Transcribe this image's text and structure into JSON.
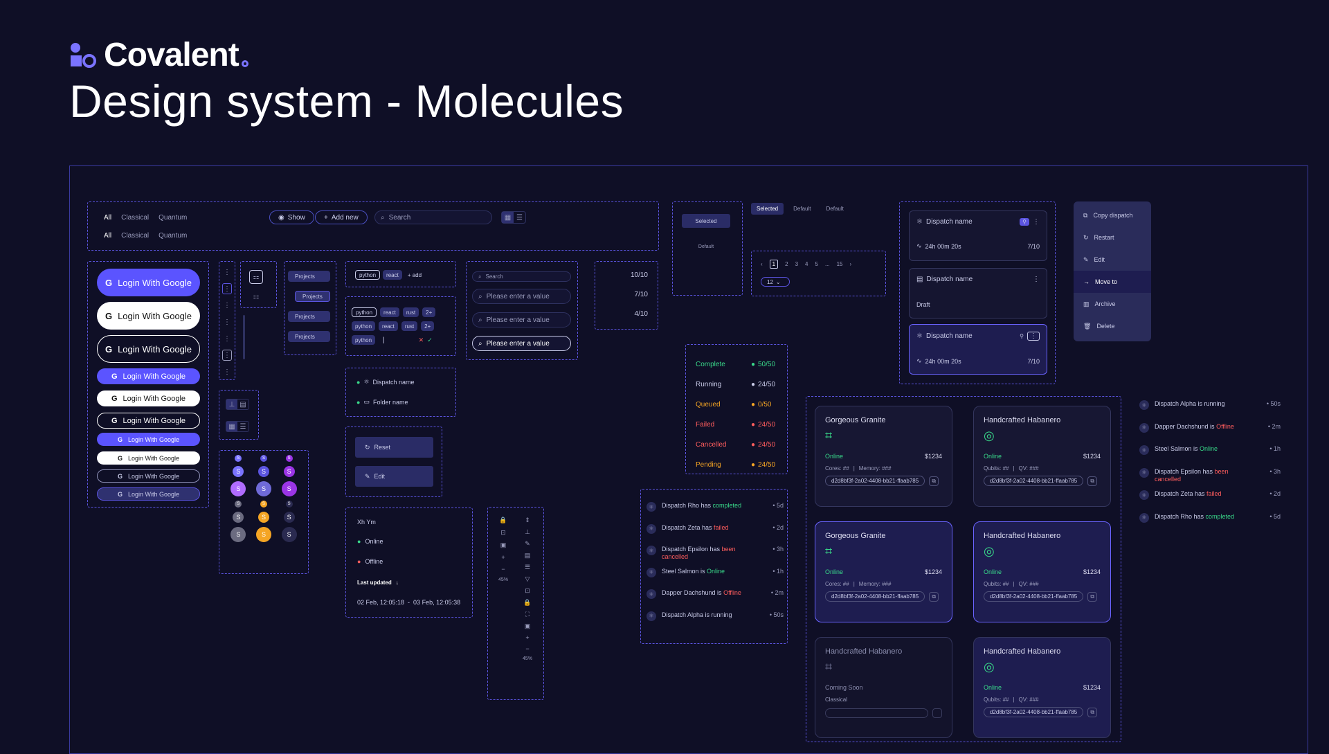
{
  "brand": {
    "name": "Covalent"
  },
  "page": {
    "title": "Design system - Molecules"
  },
  "filters": {
    "row1": [
      "All",
      "Classical",
      "Quantum"
    ],
    "row2": [
      "All",
      "Classical",
      "Quantum"
    ],
    "show": "Show",
    "add_new": "Add new",
    "search_placeholder": "Search"
  },
  "login": {
    "label": "Login With Google"
  },
  "sidebar_projects": [
    "Projects",
    "Projects",
    "Projects",
    "Projects"
  ],
  "tags": {
    "row1": [
      "python",
      "react",
      "+ add"
    ],
    "grid": [
      [
        "python",
        "react",
        "rust",
        "2+"
      ],
      [
        "python",
        "react",
        "rust",
        "2+"
      ],
      [
        "python"
      ]
    ]
  },
  "inputs": {
    "search": "Search",
    "placeholder": "Please enter a value"
  },
  "counts": [
    "10/10",
    "7/10",
    "4/10"
  ],
  "selector": {
    "selected": "Selected",
    "default": "Default"
  },
  "tabs": [
    "Selected",
    "Default",
    "Default"
  ],
  "pagination": {
    "pages": [
      "1",
      "2",
      "3",
      "4",
      "5",
      "...",
      "15"
    ],
    "per_page": "12"
  },
  "tree": {
    "dispatch": "Dispatch name",
    "folder": "Folder name"
  },
  "menu_buttons": {
    "reset": "Reset",
    "edit": "Edit"
  },
  "user_panel": {
    "initials": "Xh Ym",
    "online": "Online",
    "offline": "Offline",
    "last_updated": "Last updated",
    "range": "02 Feb, 12:05:18  -  03 Feb, 12:05:38"
  },
  "zoom": "45%",
  "status_list": [
    {
      "label": "Complete",
      "count": "50/50",
      "color": "#39d98a"
    },
    {
      "label": "Running",
      "count": "24/50",
      "color": "#c9cbe8"
    },
    {
      "label": "Queued",
      "count": "0/50",
      "color": "#f5a524"
    },
    {
      "label": "Failed",
      "count": "24/50",
      "color": "#ff5d5d"
    },
    {
      "label": "Cancelled",
      "count": "24/50",
      "color": "#ff5d5d"
    },
    {
      "label": "Pending",
      "count": "24/50",
      "color": "#f5a524"
    }
  ],
  "activity": [
    {
      "pre": "Dispatch Rho has ",
      "hl": "completed",
      "post": "",
      "cls": "ok",
      "time": "5d"
    },
    {
      "pre": "Dispatch Zeta has ",
      "hl": "failed",
      "post": "",
      "cls": "bad",
      "time": "2d"
    },
    {
      "pre": "Dispatch Epsilon has ",
      "hl": "been cancelled",
      "post": "",
      "cls": "bad",
      "time": "3h"
    },
    {
      "pre": "Steel Salmon is ",
      "hl": "Online",
      "post": "",
      "cls": "ok",
      "time": "1h"
    },
    {
      "pre": "Dapper Dachshund is ",
      "hl": "Offline",
      "post": "",
      "cls": "bad",
      "time": "2m"
    },
    {
      "pre": "Dispatch Alpha is running",
      "hl": "",
      "post": "",
      "cls": "",
      "time": "50s"
    }
  ],
  "activity_right": [
    {
      "pre": "Dispatch Alpha is running",
      "hl": "",
      "cls": "",
      "time": "50s"
    },
    {
      "pre": "Dapper Dachshund is ",
      "hl": "Offline",
      "cls": "bad",
      "time": "2m"
    },
    {
      "pre": "Steel Salmon is ",
      "hl": "Online",
      "cls": "ok",
      "time": "1h"
    },
    {
      "pre": "Dispatch Epsilon has ",
      "hl": "been cancelled",
      "cls": "bad",
      "time": "3h"
    },
    {
      "pre": "Dispatch Zeta has ",
      "hl": "failed",
      "cls": "bad",
      "time": "2d"
    },
    {
      "pre": "Dispatch Rho has ",
      "hl": "completed",
      "cls": "ok",
      "time": "5d"
    }
  ],
  "dispatch_cards": {
    "name": "Dispatch name",
    "duration": "24h 00m 20s",
    "progress": "7/10",
    "draft": "Draft"
  },
  "context_menu": [
    "Copy dispatch",
    "Restart",
    "Edit",
    "Move to",
    "Archive",
    "Delete"
  ],
  "resource_cards": {
    "granite": "Gorgeous Granite",
    "habanero": "Handcrafted Habanero",
    "online": "Online",
    "price": "$1234",
    "cores": "Cores: ##",
    "memory": "Memory: ###",
    "qubits": "Qubits: ##",
    "qv": "QV: ###",
    "hash": "d2d8bf3f-2a02-4408-bb21-ffaab785",
    "coming_soon": "Coming Soon",
    "classical": "Classical"
  },
  "colors": {
    "accent": "#5b54e0",
    "bg": "#0f0f26",
    "success": "#39d98a",
    "error": "#ff5d5d",
    "warning": "#f5a524"
  }
}
